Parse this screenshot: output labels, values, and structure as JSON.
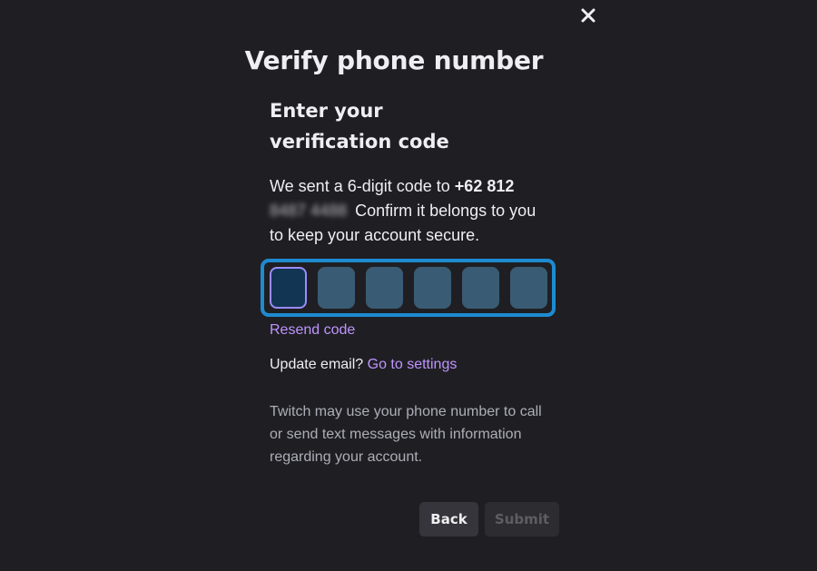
{
  "dialog": {
    "title": "Verify phone number",
    "close_icon": "close-icon"
  },
  "content": {
    "heading": "Enter your verification code",
    "desc_prefix": "We sent a 6-digit code to ",
    "phone_visible": "+62 812",
    "phone_obscured": "8487 4488",
    "desc_suffix": "Confirm it belongs to you to keep your account secure."
  },
  "code_input": {
    "digits": [
      "",
      "",
      "",
      "",
      "",
      ""
    ],
    "active_index": 0
  },
  "links": {
    "resend": "Resend code",
    "update_prefix": "Update email?",
    "go_settings": "Go to settings"
  },
  "legal": "Twitch may use your phone number to call or send text messages with information regarding your account.",
  "buttons": {
    "back": "Back",
    "submit": "Submit"
  },
  "colors": {
    "background": "#1f1f23",
    "accent_link": "#bf94ff",
    "focus_ring": "#1e8bd1"
  }
}
